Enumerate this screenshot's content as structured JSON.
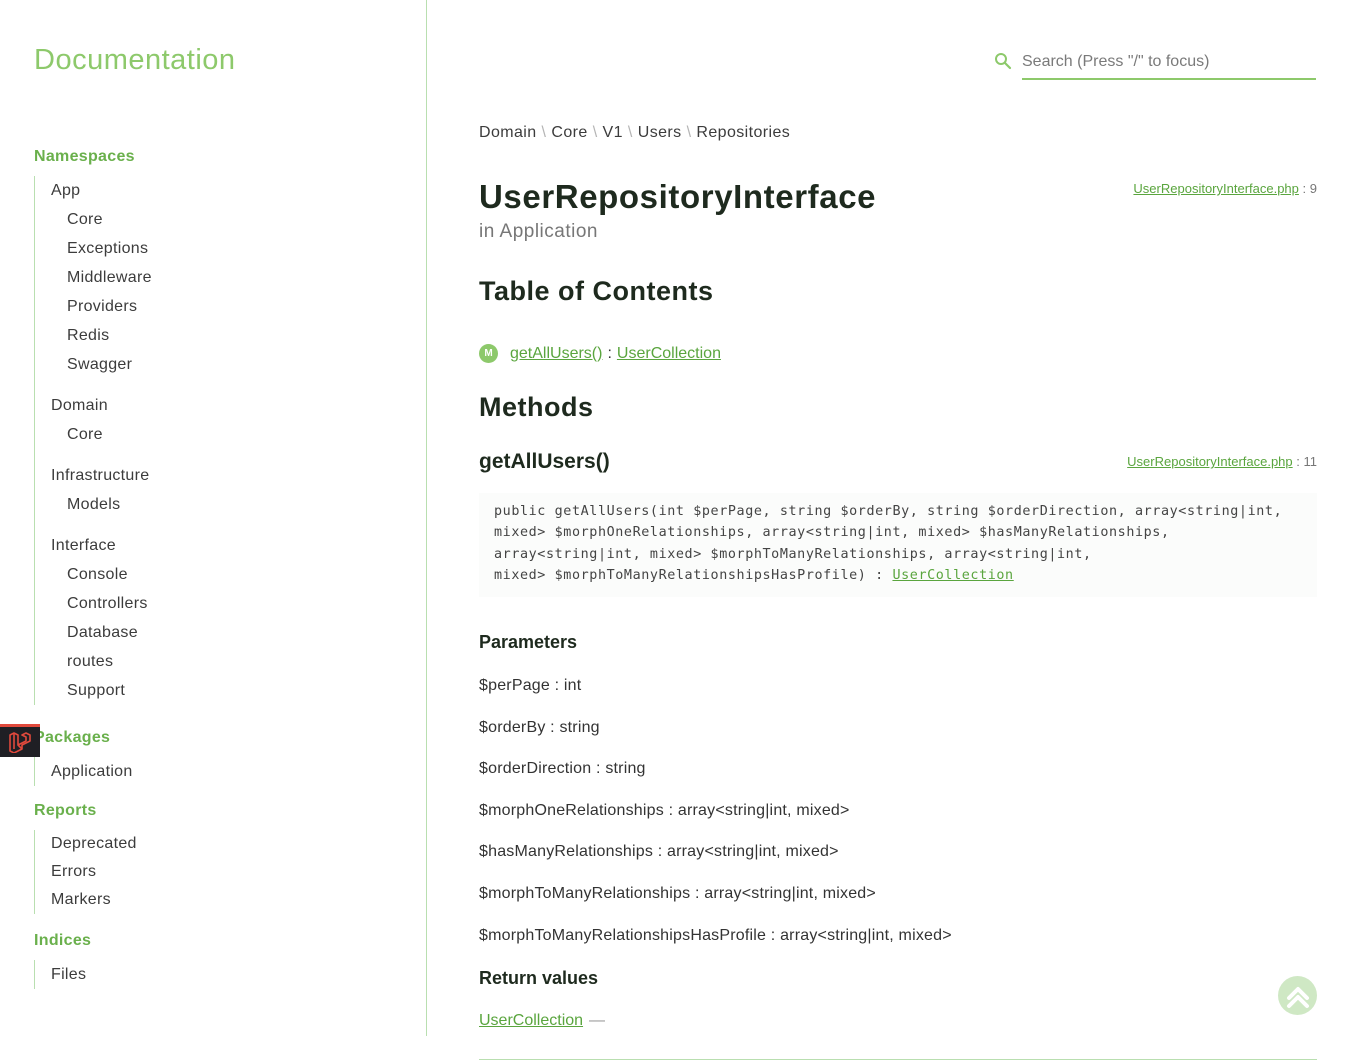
{
  "brand": "Documentation",
  "search": {
    "placeholder": "Search (Press \"/\" to focus)"
  },
  "sidebar": {
    "namespaces": {
      "heading": "Namespaces",
      "groups": [
        {
          "label": "App",
          "children": [
            "Core",
            "Exceptions",
            "Middleware",
            "Providers",
            "Redis",
            "Swagger"
          ]
        },
        {
          "label": "Domain",
          "children": [
            "Core"
          ]
        },
        {
          "label": "Infrastructure",
          "children": [
            "Models"
          ]
        },
        {
          "label": "Interface",
          "children": [
            "Console",
            "Controllers",
            "Database",
            "routes",
            "Support"
          ]
        }
      ]
    },
    "packages": {
      "heading": "Packages",
      "items": [
        "Application"
      ]
    },
    "reports": {
      "heading": "Reports",
      "items": [
        "Deprecated",
        "Errors",
        "Markers"
      ]
    },
    "indices": {
      "heading": "Indices",
      "items": [
        "Files"
      ]
    }
  },
  "breadcrumb": [
    "Domain",
    "Core",
    "V1",
    "Users",
    "Repositories"
  ],
  "breadcrumb_separator": "\\",
  "page": {
    "title": "UserRepositoryInterface",
    "subtitle": "in Application",
    "file": "UserRepositoryInterface.php",
    "file_line": ": 9"
  },
  "toc": {
    "title": "Table of Contents",
    "badge": "M",
    "method": "getAllUsers()",
    "colon": ":",
    "return_type": "UserCollection"
  },
  "methods": {
    "title": "Methods",
    "method_name": "getAllUsers()",
    "file": "UserRepositoryInterface.php",
    "file_line": ": 11",
    "signature_lines": [
      "public getAllUsers(int $perPage, string $orderBy, string $orderDirection, array<string|int,",
      "mixed> $morphOneRelationships, array<string|int, mixed> $hasManyRelationships,",
      "array<string|int, mixed> $morphToManyRelationships, array<string|int,",
      "mixed> $morphToManyRelationshipsHasProfile) : "
    ],
    "signature_return": "UserCollection",
    "parameters_title": "Parameters",
    "parameters": [
      "$perPage : int",
      "$orderBy : string",
      "$orderDirection : string",
      "$morphOneRelationships : array<string|int, mixed>",
      "$hasManyRelationships : array<string|int, mixed>",
      "$morphToManyRelationships : array<string|int, mixed>",
      "$morphToManyRelationshipsHasProfile : array<string|int, mixed>"
    ],
    "return_title": "Return values",
    "return_type": "UserCollection",
    "return_dash": "—"
  },
  "colors": {
    "accent": "#8dc96b",
    "link": "#5aa53e",
    "rule": "#b9dfb0"
  },
  "icons": {
    "search": "search-icon",
    "laravel": "laravel-logo-icon",
    "back_to_top": "chevron-up-icon"
  }
}
